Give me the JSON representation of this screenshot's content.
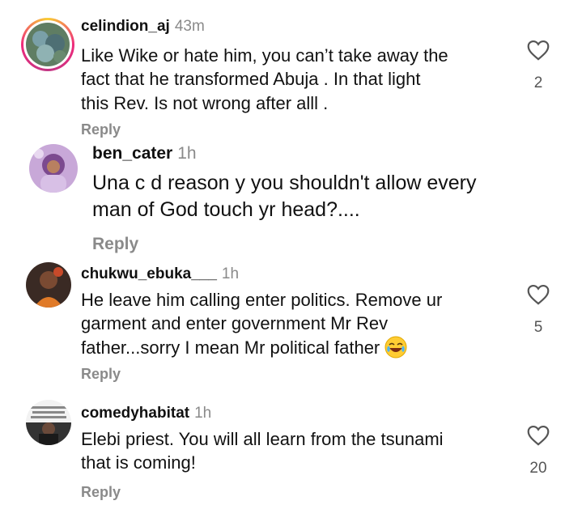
{
  "comments": [
    {
      "username": "celindion_aj",
      "time": "43m",
      "lines": [
        "Like Wike or hate him, you can’t take away the",
        "fact that he transformed Abuja . In that light",
        "this Rev. Is not wrong after alll ."
      ],
      "reply": "Reply",
      "likes": "2"
    },
    {
      "username": "ben_cater",
      "time": "1h",
      "lines": [
        "Una c d reason y you shouldn't allow every",
        "man of God touch yr head?...."
      ],
      "reply": "Reply"
    },
    {
      "username": "chukwu_ebuka___",
      "time": "1h",
      "lines": [
        "He leave him calling enter politics. Remove ur",
        "garment and enter government Mr Rev",
        "father...sorry I mean Mr political father"
      ],
      "emoji": "joy-emoji",
      "reply": "Reply",
      "likes": "5"
    },
    {
      "username": "comedyhabitat",
      "time": "1h",
      "lines": [
        "Elebi priest. You will all learn from the tsunami",
        "that is coming!"
      ],
      "reply": "Reply",
      "likes": "20"
    }
  ],
  "icons": {
    "like": "heart-outline-icon"
  },
  "colors": {
    "story_ring": "#ee2a7b",
    "muted": "#8a8a8a"
  }
}
